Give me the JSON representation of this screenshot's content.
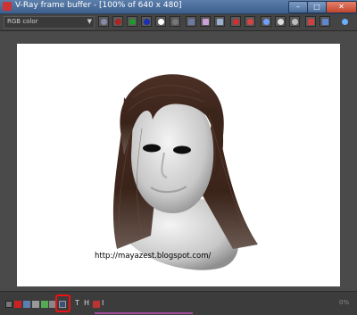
{
  "window": {
    "title": "V-Ray frame buffer - [100% of 640 x 480]"
  },
  "toolbar": {
    "channel_select": {
      "value": "RGB color"
    },
    "buttons": [
      "save-image-icon",
      "red-channel-icon",
      "green-channel-icon",
      "blue-channel-icon",
      "alpha-channel-icon",
      "monochrome-icon",
      "save-icon",
      "clear-image-icon",
      "duplicate-icon",
      "region-render-icon",
      "last-render-icon",
      "render-icon",
      "track-mouse-icon",
      "pan-icon",
      "mark-region-icon",
      "color-icon"
    ]
  },
  "render": {
    "watermark": "http://mayazest.blogspot.com/",
    "subject": "3d-head-with-hair"
  },
  "statusbar": {
    "highlighted_button": "color-corrections-icon",
    "glyph_t": "T",
    "glyph_h": "H",
    "glyph_i": "I",
    "corner_text": "0%"
  },
  "colors": {
    "title_bar": "#4a6b97",
    "toolbar_bg": "#444444",
    "viewport_bg": "#4a4a4a",
    "render_bg": "#ffffff",
    "highlight": "#ee1111",
    "hair": "#4a2b20"
  }
}
